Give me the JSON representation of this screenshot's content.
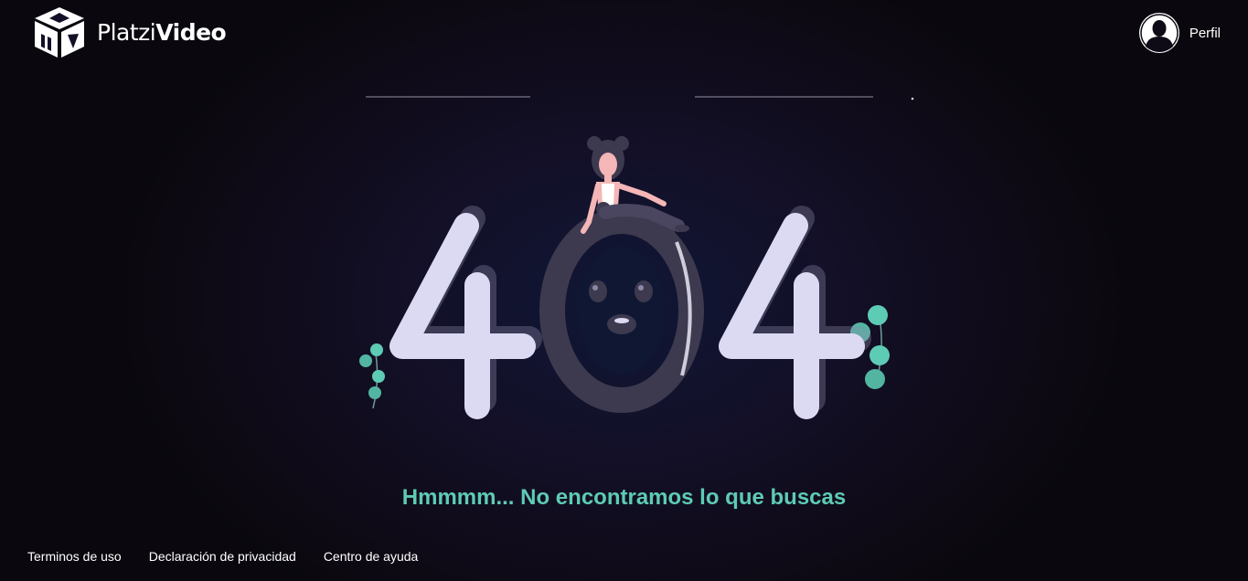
{
  "header": {
    "brand": {
      "light": "Platzi",
      "bold": "Video"
    },
    "profile_label": "Perfil"
  },
  "main": {
    "error_code": "404",
    "message": "Hmmmm... No encontramos lo que buscas"
  },
  "footer": {
    "links": [
      "Terminos de uso",
      "Declaración de privacidad",
      "Centro de ayuda"
    ]
  },
  "colors": {
    "accent": "#5ecbb5",
    "digit_fill": "#dcdaf3",
    "zero_fill": "#3d3a4f",
    "background": "#130f26"
  },
  "icons": {
    "logo": "platzi-video-cube-icon",
    "avatar": "user-avatar-icon"
  }
}
